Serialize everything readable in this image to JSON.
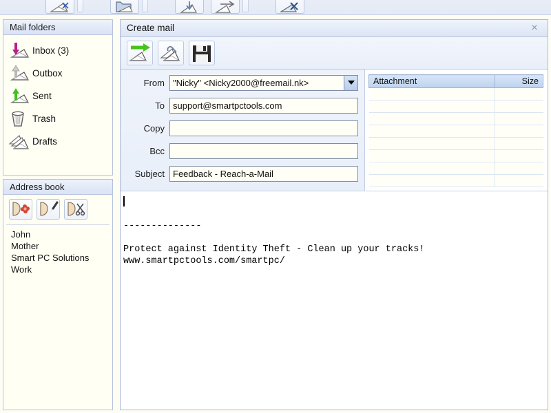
{
  "top_toolbar": {
    "buttons": [
      {
        "name": "new-mail",
        "icon": "envelope-new-icon"
      },
      {
        "name": "mail-folder",
        "icon": "envelope-folder-icon"
      },
      {
        "name": "receive-mail",
        "icon": "envelope-down-arrow-icon"
      },
      {
        "name": "send-mail",
        "icon": "envelope-right-arrow-icon"
      },
      {
        "name": "delete-mail",
        "icon": "envelope-delete-icon"
      }
    ]
  },
  "mail_folders": {
    "title": "Mail folders",
    "items": [
      {
        "label": "Inbox (3)",
        "icon": "envelope-down-arrow-icon",
        "arrow_color": "#b81e8e"
      },
      {
        "label": "Outbox",
        "icon": "envelope-up-arrow-icon",
        "arrow_color": "#b9b9b9"
      },
      {
        "label": "Sent",
        "icon": "envelope-up-arrow-icon",
        "arrow_color": "#3fc21c"
      },
      {
        "label": "Trash",
        "icon": "trash-can-icon",
        "arrow_color": ""
      },
      {
        "label": "Drafts",
        "icon": "envelope-stack-icon",
        "arrow_color": ""
      }
    ]
  },
  "address_book": {
    "title": "Address book",
    "toolbar": [
      {
        "name": "add-contact",
        "icon": "contact-add-icon"
      },
      {
        "name": "edit-contact",
        "icon": "contact-edit-pencil-icon"
      },
      {
        "name": "delete-contact",
        "icon": "contact-cut-scissors-icon"
      }
    ],
    "contacts": [
      "John",
      "Mother",
      "Smart PC Solutions",
      "Work"
    ]
  },
  "create_mail": {
    "title": "Create mail",
    "close_label": "×",
    "toolbar": [
      {
        "name": "send-button",
        "icon": "envelope-green-arrow-icon"
      },
      {
        "name": "attach-button",
        "icon": "envelope-attach-icon"
      },
      {
        "name": "save-button",
        "icon": "floppy-disk-icon"
      }
    ],
    "fields": [
      {
        "label": "From",
        "value": "\"Nicky\" <Nicky2000@freemail.nk>",
        "placeholder": "",
        "dropdown": true
      },
      {
        "label": "To",
        "value": "support@smartpctools.com",
        "placeholder": "",
        "dropdown": false
      },
      {
        "label": "Copy",
        "value": "",
        "placeholder": "",
        "dropdown": false
      },
      {
        "label": "Bcc",
        "value": "",
        "placeholder": "",
        "dropdown": false
      },
      {
        "label": "Subject",
        "value": "Feedback - Reach-a-Mail",
        "placeholder": "",
        "dropdown": false
      }
    ],
    "attachments": {
      "columns": [
        "Attachment",
        "Size"
      ],
      "rows": [],
      "empty_row_count": 8
    },
    "body": "\n--------------\n\nProtect against Identity Theft - Clean up your tracks!\nwww.smartpctools.com/smartpc/"
  },
  "colors": {
    "panel_header_start": "#eef3fb",
    "panel_header_end": "#dae3f4",
    "panel_border": "#b5c2dc",
    "page_background": "#fdfdf4",
    "field_background": "#fffff6",
    "table_header": "#bed3ef",
    "inbox_arrow": "#b81e8e",
    "sent_arrow": "#3fc21c"
  }
}
